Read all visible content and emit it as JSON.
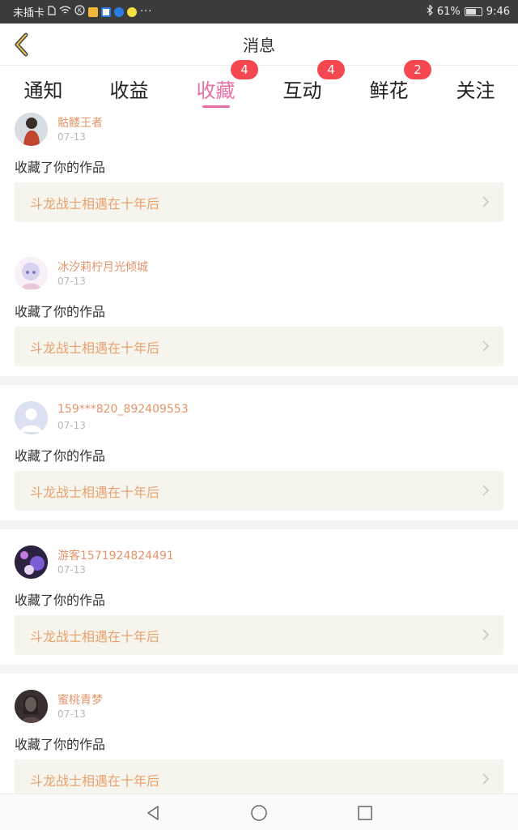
{
  "status_bar": {
    "carrier": "未插卡",
    "battery": "61%",
    "time": "9:46",
    "icons": [
      "sim-icon",
      "wifi-icon",
      "data-saver-icon",
      "app-notification-icons",
      "more-dots-icon",
      "bluetooth-icon",
      "battery-icon"
    ]
  },
  "header": {
    "title": "消息",
    "back_icon": "back-chevron-icon"
  },
  "tabs": [
    {
      "label": "通知",
      "badge": null,
      "active": false
    },
    {
      "label": "收益",
      "badge": null,
      "active": false
    },
    {
      "label": "收藏",
      "badge": "4",
      "active": true
    },
    {
      "label": "互动",
      "badge": "4",
      "active": false
    },
    {
      "label": "鲜花",
      "badge": "2",
      "active": false
    },
    {
      "label": "关注",
      "badge": null,
      "active": false
    }
  ],
  "colors": {
    "accent": "#e86fa4",
    "badge": "#f5474f",
    "username": "#e4946a",
    "work_title": "#e9a26f",
    "work_bg": "#f5f5ed"
  },
  "messages": [
    {
      "username": "骷髅王者",
      "date": "07-13",
      "action": "收藏了你的作品",
      "work_title": "斗龙战士相遇在十年后",
      "avatar": "avatar-photo"
    },
    {
      "username": "冰汐莉柠月光倾城",
      "date": "07-13",
      "action": "收藏了你的作品",
      "work_title": "斗龙战士相遇在十年后",
      "avatar": "avatar-anime-girl"
    },
    {
      "username": "159***820_892409553",
      "date": "07-13",
      "action": "收藏了你的作品",
      "work_title": "斗龙战士相遇在十年后",
      "avatar": "avatar-default"
    },
    {
      "username": "游客1571924824491",
      "date": "07-13",
      "action": "收藏了你的作品",
      "work_title": "斗龙战士相遇在十年后",
      "avatar": "avatar-anime-dark"
    },
    {
      "username": "蜜桃青梦",
      "date": "07-13",
      "action": "收藏了你的作品",
      "work_title": "斗龙战士相遇在十年后",
      "avatar": "avatar-portrait"
    }
  ],
  "nav_bar": {
    "icons": [
      "back-triangle-icon",
      "home-circle-icon",
      "recents-square-icon"
    ]
  }
}
